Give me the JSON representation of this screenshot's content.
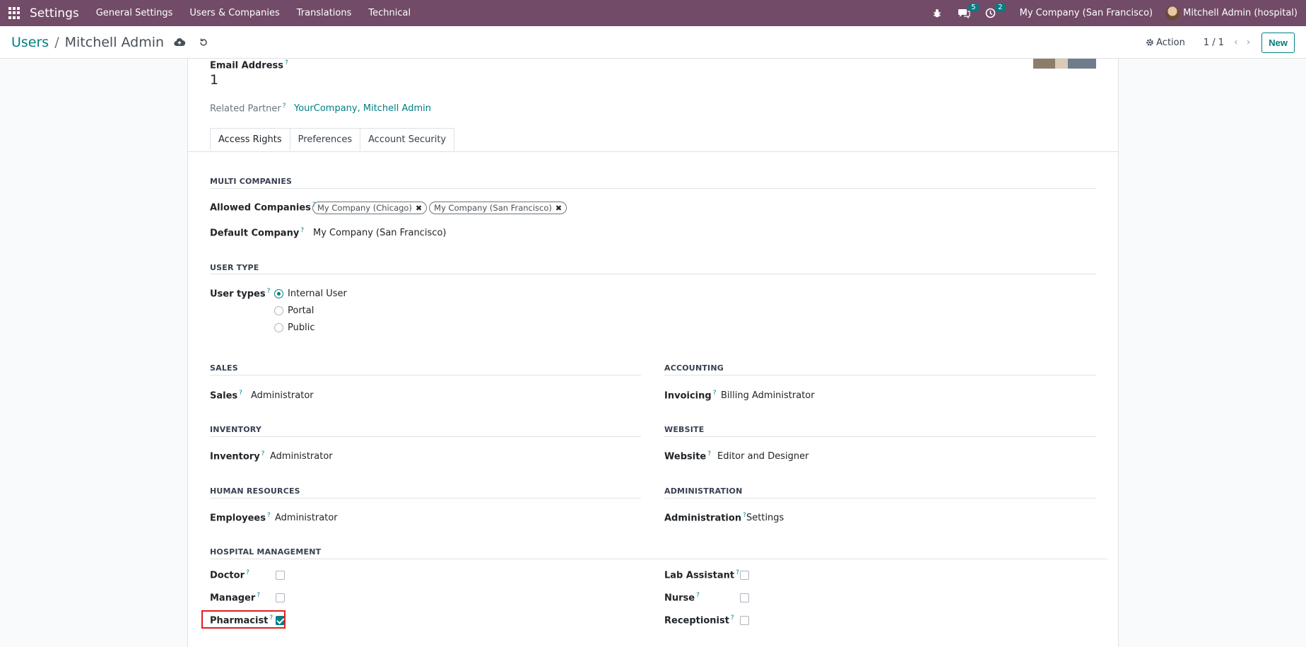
{
  "navbar": {
    "app_name": "Settings",
    "menu": [
      "General Settings",
      "Users & Companies",
      "Translations",
      "Technical"
    ],
    "messages_count": "5",
    "activities_count": "2",
    "company": "My Company (San Francisco)",
    "user": "Mitchell Admin (hospital)"
  },
  "control": {
    "breadcrumb_parent": "Users",
    "breadcrumb_sep": "/",
    "breadcrumb_current": "Mitchell Admin",
    "action_label": "Action",
    "pager": "1 / 1",
    "new_label": "New"
  },
  "form": {
    "email_label": "Email Address",
    "email_value": "1",
    "related_partner_label": "Related Partner",
    "related_partner_value": "YourCompany, Mitchell Admin",
    "tabs": [
      "Access Rights",
      "Preferences",
      "Account Security"
    ],
    "active_tab": "Access Rights"
  },
  "multi_companies": {
    "title": "MULTI COMPANIES",
    "allowed_label": "Allowed Companies",
    "allowed": [
      "My Company (Chicago)",
      "My Company (San Francisco)"
    ],
    "default_label": "Default Company",
    "default_value": "My Company (San Francisco)"
  },
  "user_type": {
    "title": "USER TYPE",
    "label": "User types",
    "options": [
      "Internal User",
      "Portal",
      "Public"
    ],
    "selected": "Internal User"
  },
  "groups": {
    "sales": {
      "title": "SALES",
      "label": "Sales",
      "value": "Administrator"
    },
    "accounting": {
      "title": "ACCOUNTING",
      "label": "Invoicing",
      "value": "Billing Administrator"
    },
    "inventory": {
      "title": "INVENTORY",
      "label": "Inventory",
      "value": "Administrator"
    },
    "website": {
      "title": "WEBSITE",
      "label": "Website",
      "value": "Editor and Designer"
    },
    "hr": {
      "title": "HUMAN RESOURCES",
      "label": "Employees",
      "value": "Administrator"
    },
    "administration": {
      "title": "ADMINISTRATION",
      "label": "Administration",
      "value": "Settings"
    }
  },
  "hospital": {
    "title": "HOSPITAL MANAGEMENT",
    "doctor": {
      "label": "Doctor",
      "checked": false
    },
    "manager": {
      "label": "Manager",
      "checked": false
    },
    "pharmacist": {
      "label": "Pharmacist",
      "checked": true
    },
    "lab_assistant": {
      "label": "Lab Assistant",
      "checked": false
    },
    "nurse": {
      "label": "Nurse",
      "checked": false
    },
    "receptionist": {
      "label": "Receptionist",
      "checked": false
    }
  },
  "colors": {
    "navbar": "#714b67",
    "accent": "#017e84",
    "highlight": "#e02020"
  }
}
